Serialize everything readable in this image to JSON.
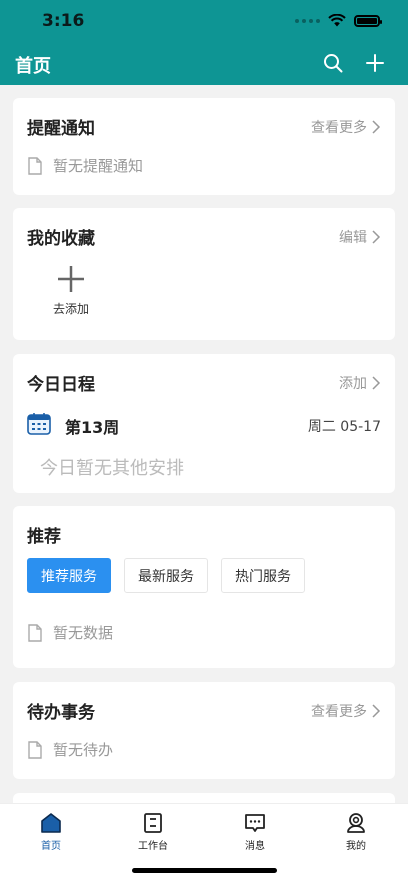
{
  "status_bar": {
    "time": "3:16"
  },
  "navbar": {
    "title": "首页",
    "search_icon": "search-icon",
    "add_icon": "plus-icon"
  },
  "reminders": {
    "title": "提醒通知",
    "more": "查看更多",
    "empty": "暂无提醒通知"
  },
  "favorites": {
    "title": "我的收藏",
    "edit": "编辑",
    "add_label": "去添加"
  },
  "schedule": {
    "title": "今日日程",
    "add": "添加",
    "week": "第13周",
    "date": "周二 05-17",
    "empty": "今日暂无其他安排"
  },
  "recommend": {
    "title": "推荐",
    "tabs": [
      {
        "label": "推荐服务",
        "active": true
      },
      {
        "label": "最新服务",
        "active": false
      },
      {
        "label": "热门服务",
        "active": false
      }
    ],
    "empty": "暂无数据"
  },
  "todo": {
    "title": "待办事务",
    "more": "查看更多",
    "empty": "暂无待办"
  },
  "tabbar": {
    "items": [
      {
        "label": "首页",
        "icon": "home-icon",
        "active": true
      },
      {
        "label": "工作台",
        "icon": "workbench-icon",
        "active": false
      },
      {
        "label": "消息",
        "icon": "message-icon",
        "active": false
      },
      {
        "label": "我的",
        "icon": "profile-icon",
        "active": false
      }
    ]
  },
  "colors": {
    "brand": "#0e9594",
    "accent": "#2b90f0",
    "tab_active": "#1a5fa8"
  }
}
